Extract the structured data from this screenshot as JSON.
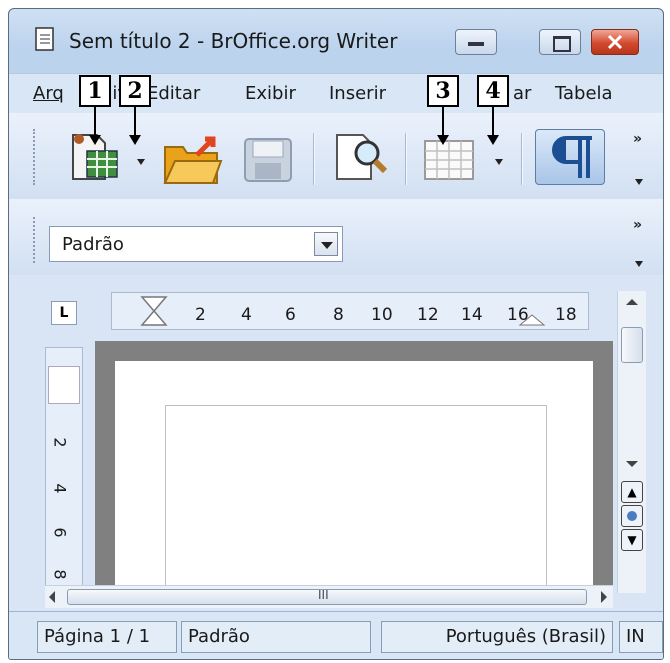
{
  "window": {
    "title": "Sem título 2 - BrOffice.org Writer",
    "minimize_label": "",
    "maximize_label": "",
    "close_label": ""
  },
  "menubar": {
    "items": [
      {
        "label": "Arquivo",
        "accel": "A"
      },
      {
        "label": "Editar",
        "accel": "E"
      },
      {
        "label": "Exibir",
        "accel": "x"
      },
      {
        "label": "Inserir",
        "accel": "I"
      },
      {
        "label": "Formatar",
        "accel": "F"
      },
      {
        "label": "Tabela",
        "accel": "T"
      }
    ],
    "visible_fragments": [
      "Arq",
      "uivo",
      "Editar",
      "Exibir",
      "Inserir",
      "ar",
      "Tabela"
    ]
  },
  "toolbar": {
    "icons": [
      "new-document-icon",
      "open-folder-icon",
      "save-icon",
      "print-preview-icon",
      "insert-table-icon",
      "formatting-marks-icon"
    ],
    "overflow": "»"
  },
  "format_toolbar": {
    "paragraph_style": "Padrão",
    "overflow": "»"
  },
  "ruler": {
    "corner": "L",
    "h_numbers": [
      "2",
      "4",
      "6",
      "8",
      "10",
      "12",
      "14",
      "16",
      "18"
    ],
    "v_numbers": [
      "2",
      "4",
      "6",
      "8"
    ]
  },
  "scrollbar": {
    "h_thumb_grip": "III"
  },
  "statusbar": {
    "page": "Página 1 / 1",
    "style": "Padrão",
    "language": "Português (Brasil)",
    "mode": "IN"
  },
  "callouts": [
    "1",
    "2",
    "3",
    "4"
  ],
  "colors": {
    "close_button": "#d24b2f",
    "chrome": "#c6d9f1",
    "page_shadow": "#808080"
  }
}
